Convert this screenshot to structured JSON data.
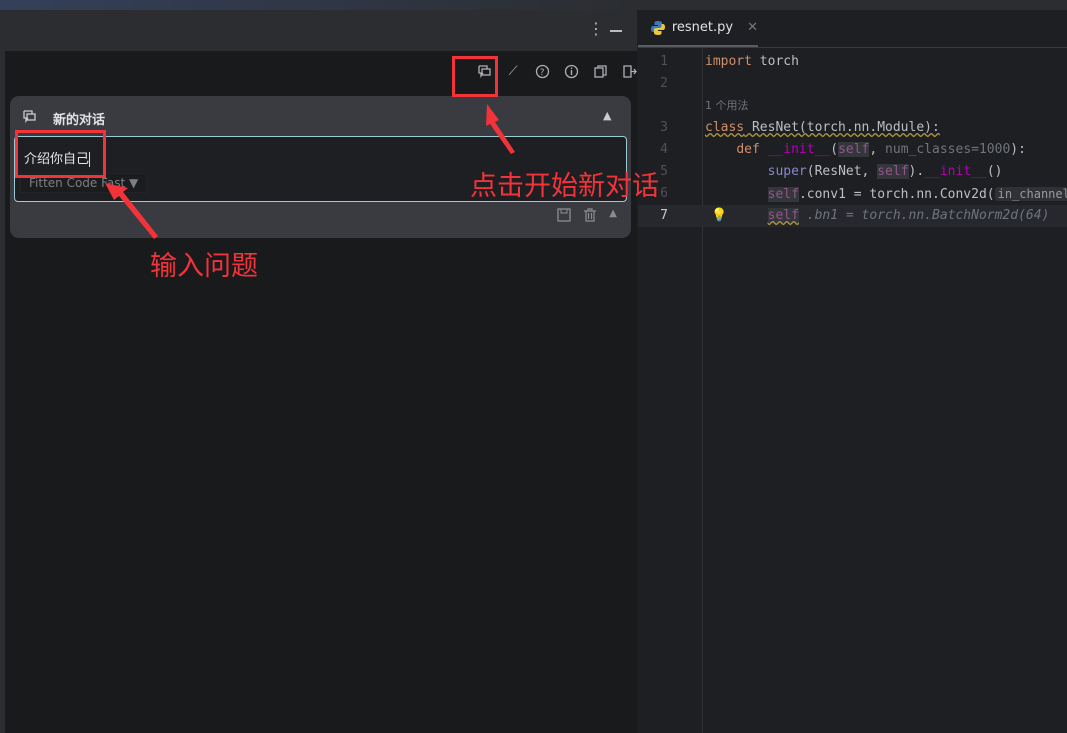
{
  "panel": {
    "title": "新的对话",
    "input_value": "介绍你自己",
    "model": "Fitten Code Fast ▼",
    "toolbar": [
      "new-chat-icon",
      "magic-wand-icon",
      "help-icon",
      "info-icon",
      "copy-icon",
      "exit-icon"
    ]
  },
  "editor": {
    "tab": "resnet.py",
    "usage_hint": "1 个用法",
    "param_hint": "in_channel",
    "lines": [
      {
        "no": "1",
        "code": "import torch"
      },
      {
        "no": "2",
        "code": ""
      },
      {
        "no": "3",
        "code": "class ResNet(torch.nn.Module):"
      },
      {
        "no": "4",
        "code": "def __init__(self, num_classes=1000):"
      },
      {
        "no": "5",
        "code": "super(ResNet, self).__init__()"
      },
      {
        "no": "6",
        "code": "self.conv1 = torch.nn.Conv2d("
      },
      {
        "no": "7",
        "code": "self .bn1 = torch.nn.BatchNorm2d(64)"
      }
    ]
  },
  "annotations": {
    "new_chat": "点击开始新对话",
    "input": "输入问题"
  },
  "colors": {
    "annotation": "#f2333a",
    "input_border": "#9ccbd6"
  }
}
